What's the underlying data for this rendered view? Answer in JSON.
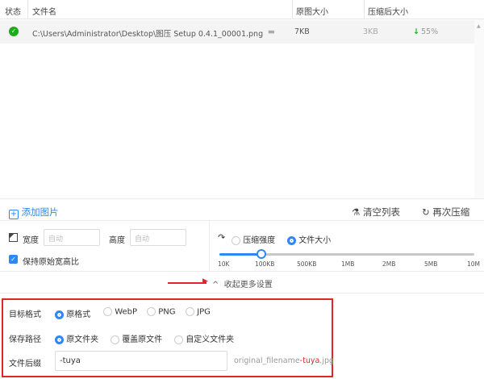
{
  "header": {
    "status": "状态",
    "filename": "文件名",
    "original_size": "原图大小",
    "compressed_size": "压缩后大小"
  },
  "files": [
    {
      "status": "success",
      "path": "C:\\Users\\Administrator\\Desktop\\图压 Setup 0.4.1_00001.png",
      "original": "7KB",
      "compressed": "3KB",
      "ratio": "55%"
    }
  ],
  "toolbar": {
    "add": "添加图片",
    "clear": "清空列表",
    "recompress": "再次压缩"
  },
  "resize": {
    "width_label": "宽度",
    "width_placeholder": "自动",
    "height_label": "高度",
    "height_placeholder": "自动",
    "keep_ratio": "保持原始宽高比",
    "keep_ratio_checked": true
  },
  "compress": {
    "mode_strength": "压缩强度",
    "mode_size": "文件大小",
    "selected": "文件大小",
    "ticks": [
      "10K",
      "100KB",
      "500KB",
      "1MB",
      "2MB",
      "5MB",
      "10M"
    ],
    "value": "100KB"
  },
  "collapse": "收起更多设置",
  "settings": {
    "format_label": "目标格式",
    "formats": [
      "原格式",
      "WebP",
      "PNG",
      "JPG"
    ],
    "format_selected": "原格式",
    "path_label": "保存路径",
    "paths": [
      "原文件夹",
      "覆盖原文件",
      "自定义文件夹"
    ],
    "path_selected": "原文件夹",
    "suffix_label": "文件后缀",
    "suffix_value": "-tuya",
    "preview_prefix": "original_filename",
    "preview_suffix": "-tuya",
    "preview_ext": ".jpg"
  },
  "colors": {
    "accent": "#2f86f6",
    "success": "#1aad19",
    "highlight": "#e3242b"
  }
}
